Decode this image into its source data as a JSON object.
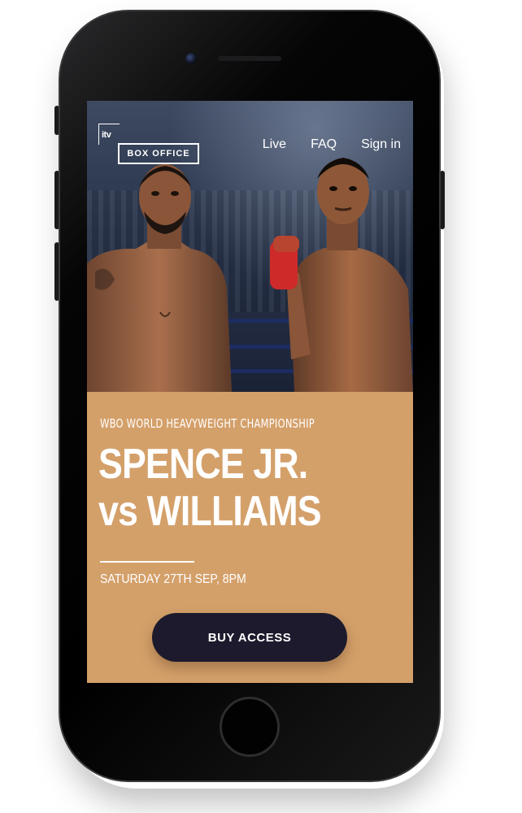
{
  "header": {
    "logo": {
      "itv": "itv",
      "box_office": "BOX OFFICE"
    },
    "nav": [
      {
        "label": "Live"
      },
      {
        "label": "FAQ"
      },
      {
        "label": "Sign in"
      }
    ]
  },
  "event": {
    "subtitle": "WBO WORLD HEAVYWEIGHT CHAMPIONSHIP",
    "title_line1": "SPENCE JR.",
    "title_line2": "vs WILLIAMS",
    "date": "SATURDAY 27TH SEP, 8PM"
  },
  "cta": {
    "buy_label": "BUY ACCESS"
  },
  "colors": {
    "accent": "#d4a06a",
    "button": "#1c1a2c",
    "text": "#ffffff"
  }
}
